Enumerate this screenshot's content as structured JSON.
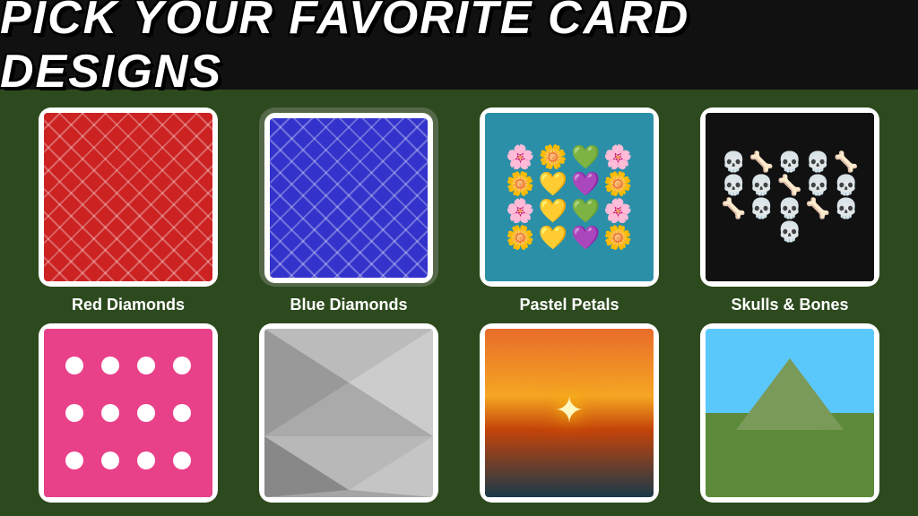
{
  "header": {
    "title": "PICK YOUR FAVORITE CARD DESIGNS"
  },
  "cards_row1": [
    {
      "id": "red-diamonds",
      "label": "Red Diamonds",
      "selected": false
    },
    {
      "id": "blue-diamonds",
      "label": "Blue Diamonds",
      "selected": true
    },
    {
      "id": "pastel-petals",
      "label": "Pastel Petals",
      "selected": false
    },
    {
      "id": "skulls-bones",
      "label": "Skulls & Bones",
      "selected": false
    }
  ],
  "cards_row2": [
    {
      "id": "pink-dots",
      "label": ""
    },
    {
      "id": "polygon",
      "label": ""
    },
    {
      "id": "sunset",
      "label": ""
    },
    {
      "id": "landscape",
      "label": ""
    }
  ],
  "flowers": [
    "🌸",
    "🌼",
    "💚",
    "🌸",
    "🌼",
    "💛",
    "💜",
    "🌼",
    "🌸",
    "💛",
    "💚",
    "🌸",
    "🌼",
    "💛",
    "💜",
    "🌼"
  ],
  "skulls": [
    "💀",
    "🦴",
    "💀",
    "💀",
    "🦴",
    "💀",
    "💀",
    "🦴",
    "💀",
    "💀",
    "🦴",
    "💀",
    "💀",
    "🦴",
    "💀",
    "💀"
  ]
}
